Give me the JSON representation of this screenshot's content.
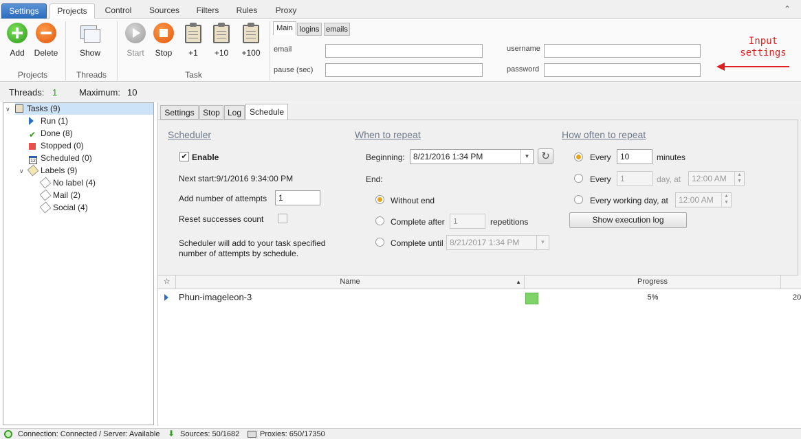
{
  "menu": {
    "tabs": [
      "Settings",
      "Projects",
      "Control",
      "Sources",
      "Filters",
      "Rules",
      "Proxy"
    ],
    "active": "Projects",
    "collapse_glyph": "⌃"
  },
  "ribbon": {
    "add_label": "Add",
    "delete_label": "Delete",
    "show_label": "Show",
    "start_label": "Start",
    "stop_label": "Stop",
    "plus1_label": "+1",
    "plus10_label": "+10",
    "plus100_label": "+100",
    "group_projects": "Projects",
    "group_threads": "Threads",
    "group_task": "Task",
    "subtabs": [
      "Main",
      "logins",
      "emails"
    ],
    "email_label": "email",
    "pause_label": "pause (sec)",
    "username_label": "username",
    "password_label": "password",
    "email_value": "",
    "pause_value": "",
    "username_value": "",
    "password_value": ""
  },
  "annotation": {
    "line1": "Input",
    "line2": "settings",
    "color": "#e02020"
  },
  "threads": {
    "threads_label": "Threads:",
    "threads_value": "1",
    "max_label": "Maximum:",
    "max_value": "10"
  },
  "tree": {
    "tasks": "Tasks (9)",
    "run": "Run (1)",
    "done": "Done (8)",
    "stopped": "Stopped (0)",
    "scheduled": "Scheduled (0)",
    "labels": "Labels (9)",
    "nolabel": "No label (4)",
    "mail": "Mail (2)",
    "social": "Social (4)",
    "calendar_day": "12"
  },
  "panel_tabs": [
    "Settings",
    "Stop",
    "Log",
    "Schedule"
  ],
  "scheduler": {
    "head_scheduler": "Scheduler",
    "head_when": "When to repeat",
    "head_how": "How often to repeat",
    "enable_label": "Enable",
    "enable_checked": true,
    "next_start": "Next start:9/1/2016 9:34:00 PM",
    "add_attempts_label": "Add number of attempts",
    "add_attempts_value": "1",
    "reset_label": "Reset successes count",
    "note_line1": "Scheduler will add to your task specified",
    "note_line2": "number of attempts by schedule.",
    "beginning_label": "Beginning:",
    "beginning_value": "8/21/2016 1:34 PM",
    "end_label": "End:",
    "without_end": "Without end",
    "complete_after": "Complete after",
    "complete_after_value": "1",
    "repetitions": "repetitions",
    "complete_until": "Complete until",
    "complete_until_value": "8/21/2017 1:34 PM",
    "every1": "Every",
    "every1_value": "10",
    "minutes": "minutes",
    "every2": "Every",
    "every2_value": "1",
    "day_at": "day, at",
    "time1": "12:00 AM",
    "every_working": "Every working day, at",
    "time2": "12:00 AM",
    "show_log": "Show execution log",
    "refresh_glyph": "↻"
  },
  "grid": {
    "headers": {
      "star": "☆",
      "name": "Name",
      "progress": "Progress",
      "last": ""
    },
    "sort_glyph": "▲",
    "row": {
      "name": "Phun-imageleon-3",
      "progress": 5,
      "progress_text": "5%",
      "last": "20"
    }
  },
  "status": {
    "connection": "Connection: Connected / Server: Available",
    "sources": "Sources: 50/1682",
    "proxies": "Proxies: 650/17350"
  }
}
